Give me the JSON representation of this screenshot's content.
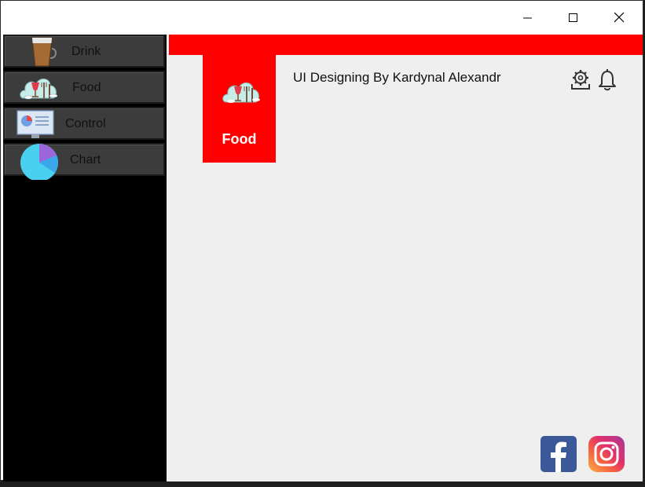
{
  "titlebar": {
    "buttons": [
      {
        "name": "minimize-icon"
      },
      {
        "name": "maximize-icon"
      },
      {
        "name": "close-icon"
      }
    ]
  },
  "sidebar": {
    "items": [
      {
        "label": "Drink",
        "icon": "drink-icon"
      },
      {
        "label": "Food",
        "icon": "food-icon"
      },
      {
        "label": "Control",
        "icon": "control-icon"
      },
      {
        "label": "Chart",
        "icon": "chart-icon"
      }
    ]
  },
  "main": {
    "tile_label": "Food",
    "heading": "UI Designing By Kardynal Alexandr",
    "header_icons": [
      "settings-icon",
      "bell-icon"
    ],
    "social_icons": [
      "facebook-icon",
      "instagram-icon"
    ]
  },
  "colors": {
    "accent": "#ff0000",
    "sidebar_bg": "#000000",
    "nav_item_bg": "#3c3c3c",
    "content_bg": "#efefef"
  }
}
